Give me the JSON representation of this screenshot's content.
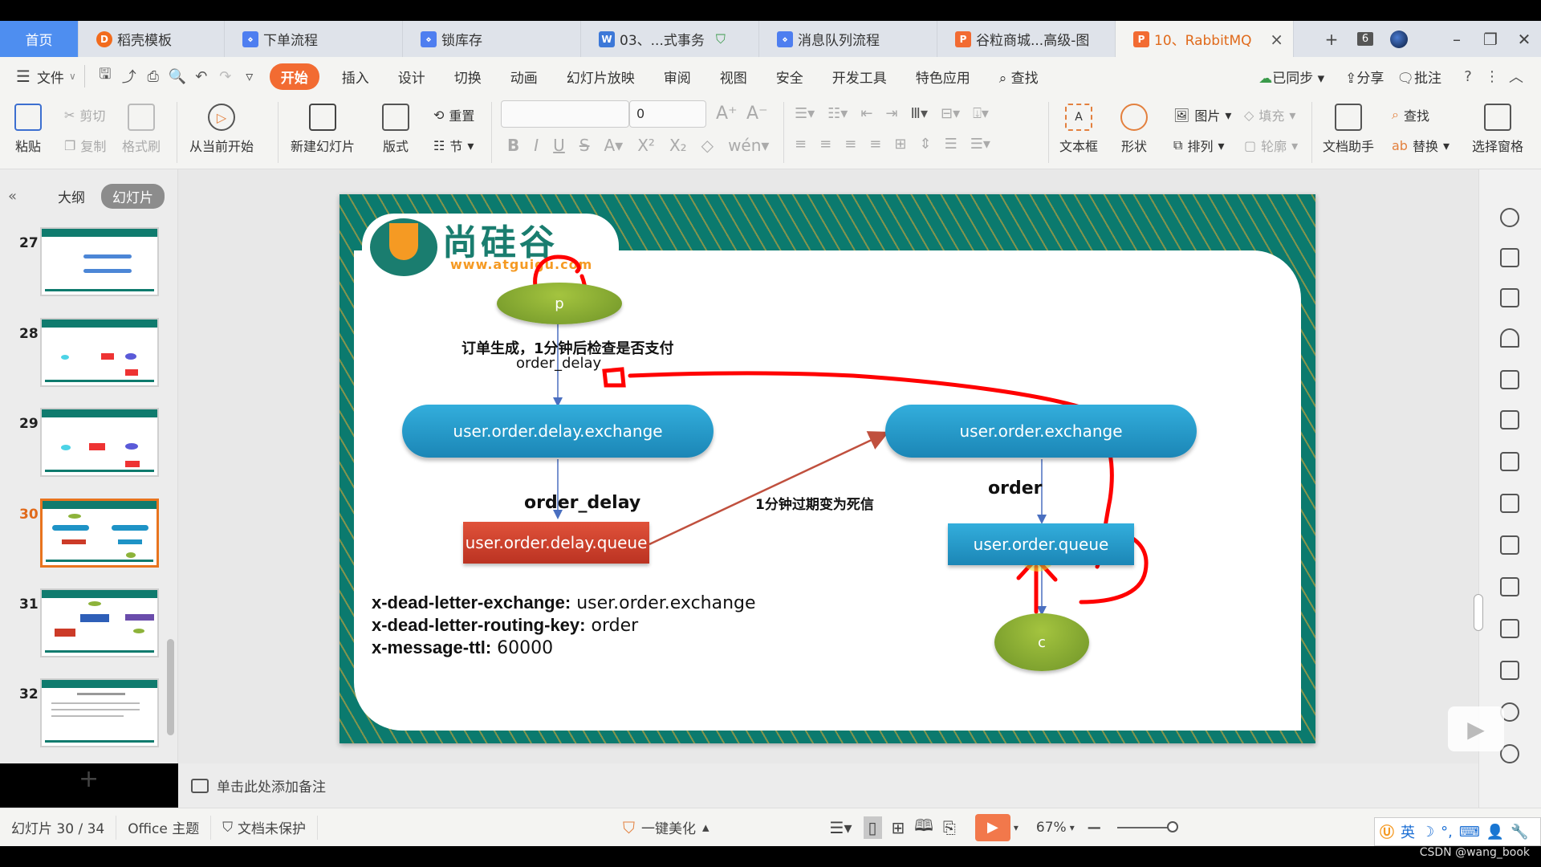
{
  "tabs": [
    {
      "label": "首页",
      "type": "home"
    },
    {
      "label": "稻壳模板",
      "icon": "docer-icon",
      "icon_color": "#f26b1d"
    },
    {
      "label": "下单流程",
      "icon": "flowchart-icon",
      "icon_color": "#4e7ef0"
    },
    {
      "label": "锁库存",
      "icon": "flowchart-icon",
      "icon_color": "#4e7ef0"
    },
    {
      "label": "03、...式事务",
      "icon": "word-icon",
      "icon_color": "#3c78d8",
      "badge": "shield-icon"
    },
    {
      "label": "消息队列流程",
      "icon": "flowchart-icon",
      "icon_color": "#4e7ef0"
    },
    {
      "label": "谷粒商城...高级-图",
      "icon": "ppt-icon",
      "icon_color": "#f26b32"
    },
    {
      "label": "10、RabbitMQ",
      "icon": "ppt-icon",
      "icon_color": "#f26b32",
      "active": true
    }
  ],
  "tab_controls": {
    "add": "+",
    "count": "6"
  },
  "menu": {
    "file": "文件",
    "items": [
      "开始",
      "插入",
      "设计",
      "切换",
      "动画",
      "幻灯片放映",
      "审阅",
      "视图",
      "安全",
      "开发工具",
      "特色应用"
    ],
    "active": "开始",
    "search": "查找",
    "sync": "已同步",
    "share": "分享",
    "comment": "批注"
  },
  "ribbon": {
    "paste": "粘贴",
    "cut": "剪切",
    "copy": "复制",
    "format_painter": "格式刷",
    "play_from_current": "从当前开始",
    "new_slide": "新建幻灯片",
    "layout": "版式",
    "reset": "重置",
    "section": "节",
    "font_name": "",
    "font_size": "0",
    "textbox": "文本框",
    "shape": "形状",
    "picture": "图片",
    "arrange": "排列",
    "fill": "填充",
    "outline": "轮廓",
    "doc_assistant": "文档助手",
    "find": "查找",
    "replace": "替换",
    "selection_pane": "选择窗格"
  },
  "left_panel": {
    "outline_tab": "大纲",
    "slides_tab": "幻灯片",
    "slides": [
      {
        "num": "27"
      },
      {
        "num": "28"
      },
      {
        "num": "29"
      },
      {
        "num": "30",
        "active": true
      },
      {
        "num": "31"
      },
      {
        "num": "32"
      }
    ]
  },
  "slide": {
    "logo_name": "尚硅谷",
    "logo_url": "www.atguigu.com",
    "producer": "p",
    "consumer": "c",
    "producer_label_cn": "订单生成，1分钟后检查是否支付",
    "producer_label_key": "order_delay",
    "delay_exchange": "user.order.delay.exchange",
    "delay_routing_key": "order_delay",
    "delay_queue": "user.order.delay.queue",
    "dead_letter_label": "1分钟过期变为死信",
    "order_exchange": "user.order.exchange",
    "order_routing_key": "order",
    "order_queue": "user.order.queue",
    "props": [
      {
        "key": "x-dead-letter-exchange:",
        "value": "user.order.exchange"
      },
      {
        "key": "x-dead-letter-routing-key:",
        "value": "order"
      },
      {
        "key": "x-message-ttl:",
        "value": "60000"
      }
    ],
    "colors": {
      "exchange": "#1e93c6",
      "queue_delay": "#cc3b28",
      "node": "#8db33a",
      "annotation": "#ff0000",
      "frame": "#0b7a6e"
    }
  },
  "notes_placeholder": "单击此处添加备注",
  "status": {
    "slide_info": "幻灯片 30 / 34",
    "theme": "Office 主题",
    "protection": "文档未保护",
    "beautify": "一键美化",
    "zoom": "67%"
  },
  "ime": {
    "lang": "英"
  },
  "watermark": "CSDN @wang_book"
}
